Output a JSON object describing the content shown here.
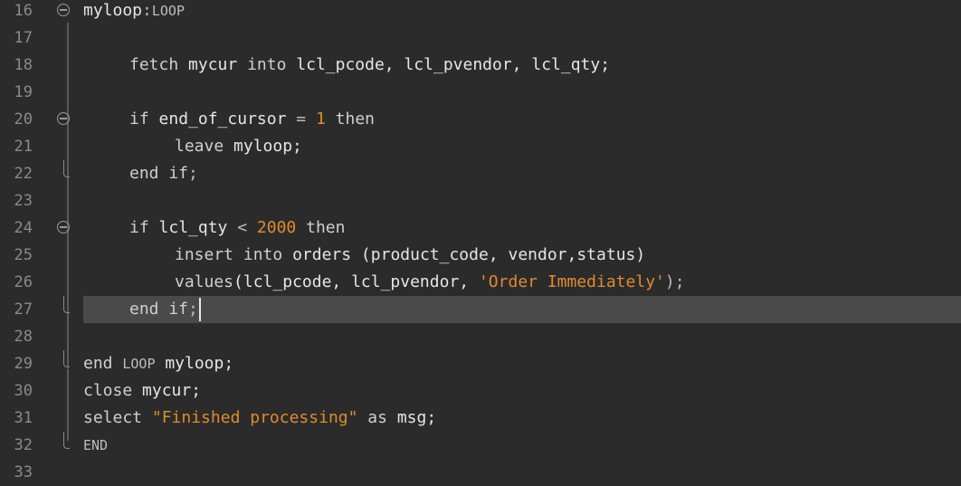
{
  "editor": {
    "line_numbers": [
      "16",
      "17",
      "18",
      "19",
      "20",
      "21",
      "22",
      "23",
      "24",
      "25",
      "26",
      "27",
      "28",
      "29",
      "30",
      "31",
      "32",
      "33"
    ],
    "lines": {
      "l16": {
        "ident": "myloop",
        "colon": ":",
        "kw": "LOOP"
      },
      "l18": {
        "kw1": "fetch",
        "ident1": "mycur",
        "kw2": "into",
        "rest": "lcl_pcode, lcl_pvendor, lcl_qty;"
      },
      "l20": {
        "kw1": "if",
        "ident1": "end_of_cursor",
        "op": "=",
        "num": "1",
        "kw2": "then"
      },
      "l21": {
        "kw1": "leave",
        "rest": "myloop;"
      },
      "l22": {
        "kw1": "end if",
        "rest": ";"
      },
      "l24": {
        "kw1": "if",
        "ident1": "lcl_qty",
        "op": "<",
        "num": "2000",
        "kw2": "then"
      },
      "l25": {
        "kw1": "insert",
        "kw2": "into",
        "rest": "orders (product_code, vendor,status)"
      },
      "l26": {
        "kw1": "values",
        "pre": "(lcl_pcode, lcl_pvendor, ",
        "str": "'Order Immediately'",
        "post": ");"
      },
      "l27": {
        "kw1": "end if",
        "rest": ";"
      },
      "l29": {
        "kw1": "end",
        "kw2": "LOOP",
        "rest": "myloop;"
      },
      "l30": {
        "kw1": "close",
        "rest": "mycur;"
      },
      "l31": {
        "kw1": "select",
        "str": "\"Finished processing\"",
        "kw2": "as",
        "rest": "msg;"
      },
      "l32": {
        "kw1": "END"
      }
    }
  },
  "colors": {
    "background": "#2b2b2b",
    "current_line": "#4a4a4a",
    "literal": "#e08a2e",
    "gutter_text": "#8a8a8a"
  }
}
